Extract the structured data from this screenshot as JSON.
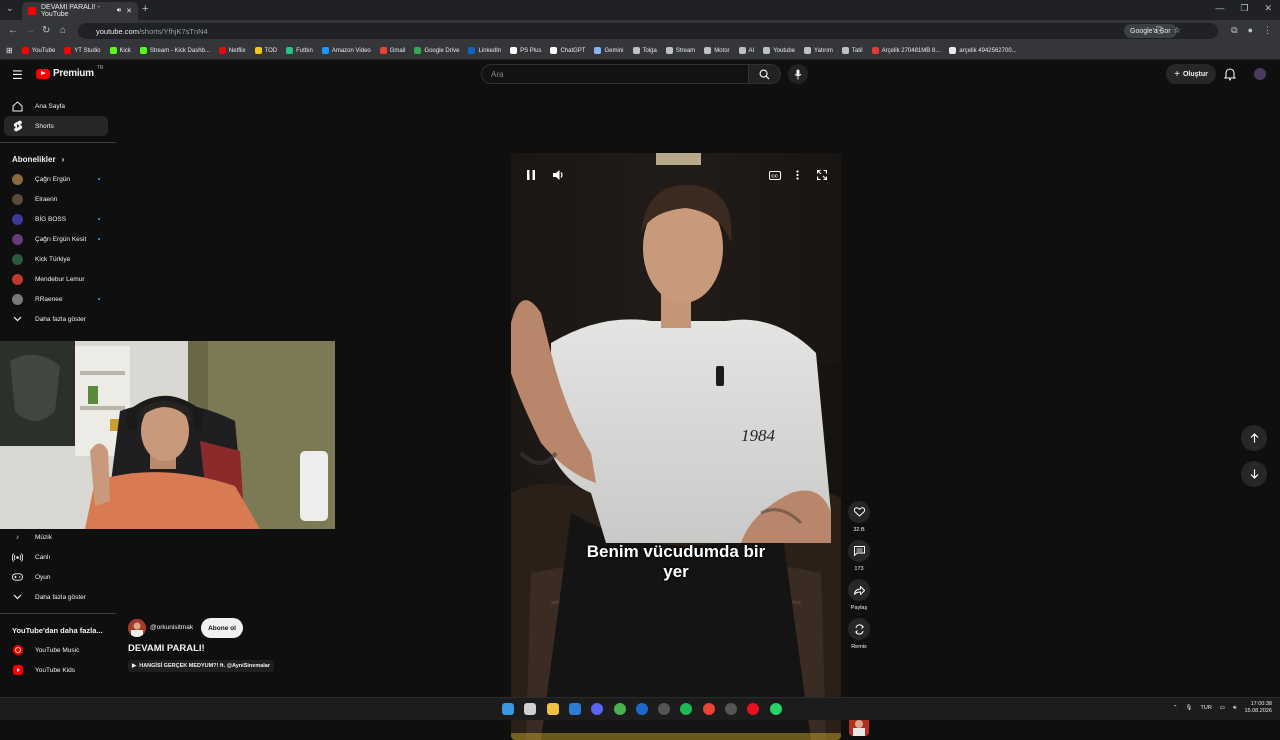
{
  "browser": {
    "tab_title": "DEVAMI PARALI! - YouTube",
    "new_tab": "+",
    "url_host": "youtube.com",
    "url_path": "/shorts/YfhjK7sTnN4",
    "google_sor": "Google'a Sor",
    "window_controls": [
      "—",
      "❐",
      "✕"
    ]
  },
  "bookmarks": [
    {
      "label": "YouTube",
      "color": "#ff0000"
    },
    {
      "label": "YT Studio",
      "color": "#ff0000"
    },
    {
      "label": "Kick",
      "color": "#53fc18"
    },
    {
      "label": "Stream - Kick Dashb...",
      "color": "#53fc18"
    },
    {
      "label": "Netflix",
      "color": "#e50914"
    },
    {
      "label": "TOD",
      "color": "#f5c518"
    },
    {
      "label": "Futbin",
      "color": "#26c281"
    },
    {
      "label": "Amazon Video",
      "color": "#1a98ff"
    },
    {
      "label": "Gmail",
      "color": "#ea4335"
    },
    {
      "label": "Google Drive",
      "color": "#34a853"
    },
    {
      "label": "LinkedIn",
      "color": "#0a66c2"
    },
    {
      "label": "PS Plus",
      "color": "#ffffff"
    },
    {
      "label": "ChatGPT",
      "color": "#ffffff"
    },
    {
      "label": "Gemini",
      "color": "#8ab4f8"
    },
    {
      "label": "Tolga",
      "color": "#bdc1c6"
    },
    {
      "label": "Stream",
      "color": "#bdc1c6"
    },
    {
      "label": "Motor",
      "color": "#bdc1c6"
    },
    {
      "label": "AI",
      "color": "#bdc1c6"
    },
    {
      "label": "Youtube",
      "color": "#bdc1c6"
    },
    {
      "label": "Yatırım",
      "color": "#bdc1c6"
    },
    {
      "label": "Tatil",
      "color": "#bdc1c6"
    },
    {
      "label": "Arçelik 270481MB 8...",
      "color": "#e53935"
    },
    {
      "label": "arçelik 4942562700...",
      "color": "#e8eaed"
    }
  ],
  "yt": {
    "logo_text": "Premium",
    "logo_region": "TR",
    "search_placeholder": "Ara",
    "create_label": "Oluştur"
  },
  "sidebar": {
    "main": [
      {
        "label": "Ana Sayfa",
        "icon": "home-icon"
      },
      {
        "label": "Shorts",
        "icon": "shorts-icon"
      }
    ],
    "subs_heading": "Abonelikler",
    "subs_chevron": "›",
    "subscriptions": [
      {
        "label": "Çağrı Ergün",
        "color": "#8a6a3a",
        "live": true
      },
      {
        "label": "Elraenn",
        "color": "#5a4a3a",
        "live": false
      },
      {
        "label": "BİG BOSS",
        "color": "#3a3a9a",
        "live": true
      },
      {
        "label": "Çağrı Ergün Kesit",
        "color": "#6a3a7a",
        "live": true
      },
      {
        "label": "Kick Türkiye",
        "color": "#2a5a3a",
        "live": false
      },
      {
        "label": "Mendebur Lemur",
        "color": "#c0392b",
        "live": false
      },
      {
        "label": "RRaenee",
        "color": "#7a7a7a",
        "live": true
      }
    ],
    "show_more": "Daha fazla göster",
    "explore": [
      {
        "label": "Müzik",
        "icon": "music-icon"
      },
      {
        "label": "Canlı",
        "icon": "live-icon"
      },
      {
        "label": "Oyun",
        "icon": "gaming-icon"
      }
    ],
    "show_more2": "Daha fazla göster",
    "more_heading": "YouTube'dan daha fazla...",
    "more_items": [
      {
        "label": "YouTube Music",
        "icon": "youtube-music-icon"
      },
      {
        "label": "YouTube Kids",
        "icon": "youtube-kids-icon"
      }
    ]
  },
  "short": {
    "caption_line1": "Benim vücudumda bir",
    "caption_line2": "yer",
    "shirt_text": "1984",
    "likes": "32 B",
    "comments": "173",
    "share": "Paylaş",
    "remix": "Remix",
    "channel": "@orkunisitmak",
    "subscribe": "Abone ol",
    "title": "DEVAMI PARALI!",
    "related": "HANGİSİ GERÇEK MEDYUM?! ft. @AyniSinemalar",
    "related_prefix": "▶"
  },
  "taskbar": {
    "lang": "TUR",
    "time": "17:00:38",
    "date": "15.08.2026"
  }
}
